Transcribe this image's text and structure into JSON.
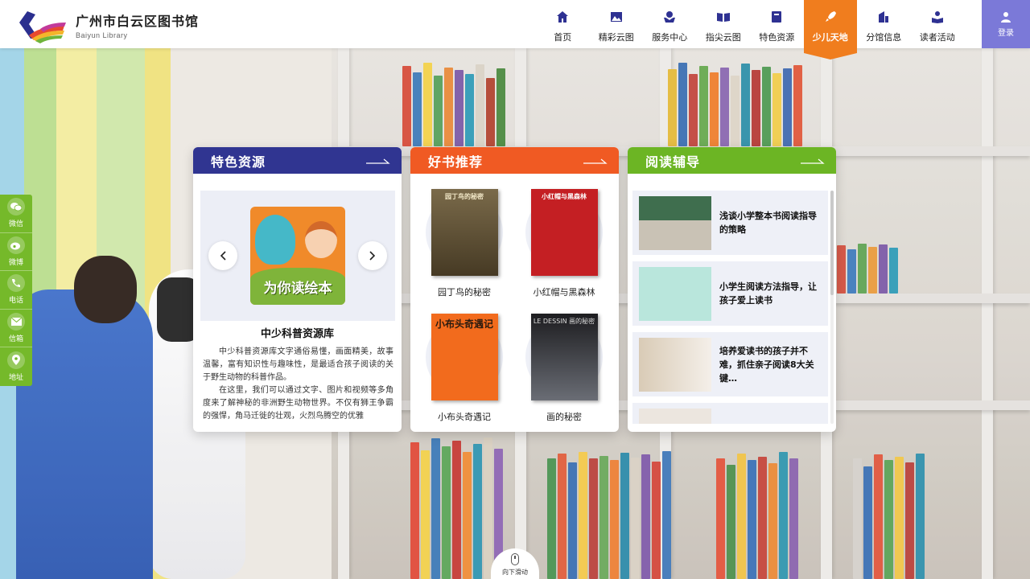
{
  "header": {
    "logo_cn": "广州市白云区图书馆",
    "logo_en": "Baiyun Library",
    "nav": [
      {
        "label": "首页",
        "icon": "home-icon"
      },
      {
        "label": "精彩云图",
        "icon": "gallery-icon"
      },
      {
        "label": "服务中心",
        "icon": "service-icon"
      },
      {
        "label": "指尖云图",
        "icon": "open-book-icon"
      },
      {
        "label": "特色资源",
        "icon": "book-icon"
      },
      {
        "label": "少儿天地",
        "icon": "rocket-icon",
        "active": true
      },
      {
        "label": "分馆信息",
        "icon": "branch-icon"
      },
      {
        "label": "读者活动",
        "icon": "reader-icon"
      }
    ],
    "login_label": "登录"
  },
  "social": [
    {
      "label": "微信",
      "icon": "wechat-icon"
    },
    {
      "label": "微博",
      "icon": "weibo-icon"
    },
    {
      "label": "电话",
      "icon": "phone-icon"
    },
    {
      "label": "信箱",
      "icon": "mail-icon"
    },
    {
      "label": "地址",
      "icon": "location-icon"
    }
  ],
  "cards": {
    "featured": {
      "title": "特色资源",
      "slide_caption": "为你读绘本",
      "resource_title": "中少科普资源库",
      "desc_p1": "中少科普资源库文字通俗易懂，画面精美，故事温馨，富有知识性与趣味性，是最适合孩子阅读的关于野生动物的科普作品。",
      "desc_p2": "在这里，我们可以通过文字、图片和视频等多角度来了解神秘的非洲野生动物世界。不仅有狮王争霸的强悍，角马迁徙的壮观，火烈鸟腾空的优雅"
    },
    "books": {
      "title": "好书推荐",
      "items": [
        {
          "name": "园丁鸟的秘密",
          "cover_text": "园丁鸟的秘密"
        },
        {
          "name": "小红帽与黑森林",
          "cover_text": "小红帽与黑森林"
        },
        {
          "name": "小布头奇遇记",
          "cover_text": "小布头奇遇记"
        },
        {
          "name": "画的秘密",
          "cover_text": "LE DESSIN 画的秘密"
        }
      ]
    },
    "guide": {
      "title": "阅读辅导",
      "items": [
        {
          "text": "浅谈小学整本书阅读指导的策略"
        },
        {
          "text": "小学生阅读方法指导，让孩子爱上读书"
        },
        {
          "text": "培养爱读书的孩子并不难，抓住亲子阅读8大关键…"
        },
        {
          "text": ""
        }
      ]
    }
  },
  "scroll_hint": "向下滑动",
  "colors": {
    "primary_blue": "#303591",
    "orange": "#f05a23",
    "green": "#6cb524",
    "nav_active": "#f07d1e",
    "login": "#7b79d8",
    "social": "#75b92a"
  }
}
